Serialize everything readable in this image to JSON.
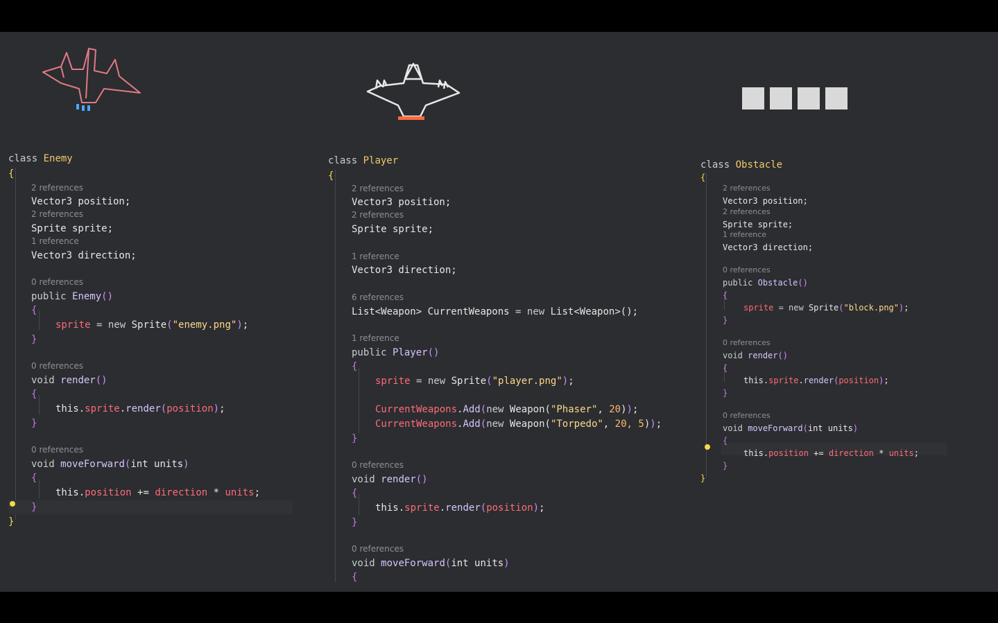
{
  "enemy": {
    "header_kw": "class",
    "header_name": "Enemy",
    "refs": [
      "2 references",
      "2 references",
      "1 reference",
      "0 references",
      "0 references",
      "0 references"
    ],
    "fields": [
      "Vector3 position;",
      "Sprite sprite;",
      "Vector3 direction;"
    ],
    "ctor_sig": "Enemy",
    "ctor_body": {
      "field": "sprite",
      "op": " = new ",
      "cls": "Sprite",
      "str": "\"enemy.png\""
    },
    "render_sig": "render",
    "render_body": {
      "this": "this",
      "field": "sprite",
      "call": "render",
      "arg": "position"
    },
    "move_sig": "moveForward",
    "move_param": "int units",
    "move_body": {
      "this": "this",
      "field": "position",
      "op": " += ",
      "dir": "direction",
      "mul": " * ",
      "units": "units"
    }
  },
  "player": {
    "header_kw": "class",
    "header_name": "Player",
    "refs": [
      "2 references",
      "2 references",
      "1 reference",
      "6 references",
      "1 reference",
      "0 references",
      "0 references"
    ],
    "fields": [
      "Vector3 position;",
      "Sprite sprite;",
      "Vector3 direction;"
    ],
    "list_line": {
      "type": "List<Weapon>",
      "name": "CurrentWeapons",
      "op": " = new ",
      "type2": "List<Weapon>",
      "tail": "();"
    },
    "ctor_sig": "Player",
    "ctor_sprite": {
      "field": "sprite",
      "op": " = new ",
      "cls": "Sprite",
      "str": "\"player.png\""
    },
    "weapon1": {
      "field": "CurrentWeapons",
      "call": "Add",
      "cls": "Weapon",
      "str": "\"Phaser\"",
      "nums": "20"
    },
    "weapon2": {
      "field": "CurrentWeapons",
      "call": "Add",
      "cls": "Weapon",
      "str": "\"Torpedo\"",
      "nums": "20, 5"
    },
    "render_sig": "render",
    "render_body": {
      "this": "this",
      "field": "sprite",
      "call": "render",
      "arg": "position"
    },
    "move_sig": "moveForward",
    "move_param": "int units"
  },
  "obstacle": {
    "header_kw": "class",
    "header_name": "Obstacle",
    "refs": [
      "2 references",
      "2 references",
      "1 reference",
      "0 references",
      "0 references",
      "0 references"
    ],
    "fields": [
      "Vector3 position;",
      "Sprite sprite;",
      "Vector3 direction;"
    ],
    "ctor_sig": "Obstacle",
    "ctor_body": {
      "field": "sprite",
      "op": " = new ",
      "cls": "Sprite",
      "str": "\"block.png\""
    },
    "render_sig": "render",
    "render_body": {
      "this": "this",
      "field": "sprite",
      "call": "render",
      "arg": "position"
    },
    "move_sig": "moveForward",
    "move_param": "int units",
    "move_body": {
      "this": "this",
      "field": "position",
      "op": " += ",
      "dir": "direction",
      "mul": " * ",
      "units": "units"
    }
  },
  "tokens": {
    "public": "public",
    "void": "void",
    "new": "new",
    "open": "{",
    "close": "}"
  },
  "colors": {
    "background": "#2b2d30",
    "keyword_class": "#f2c86b",
    "field": "#ff6b7a",
    "string": "#ffd98a"
  }
}
